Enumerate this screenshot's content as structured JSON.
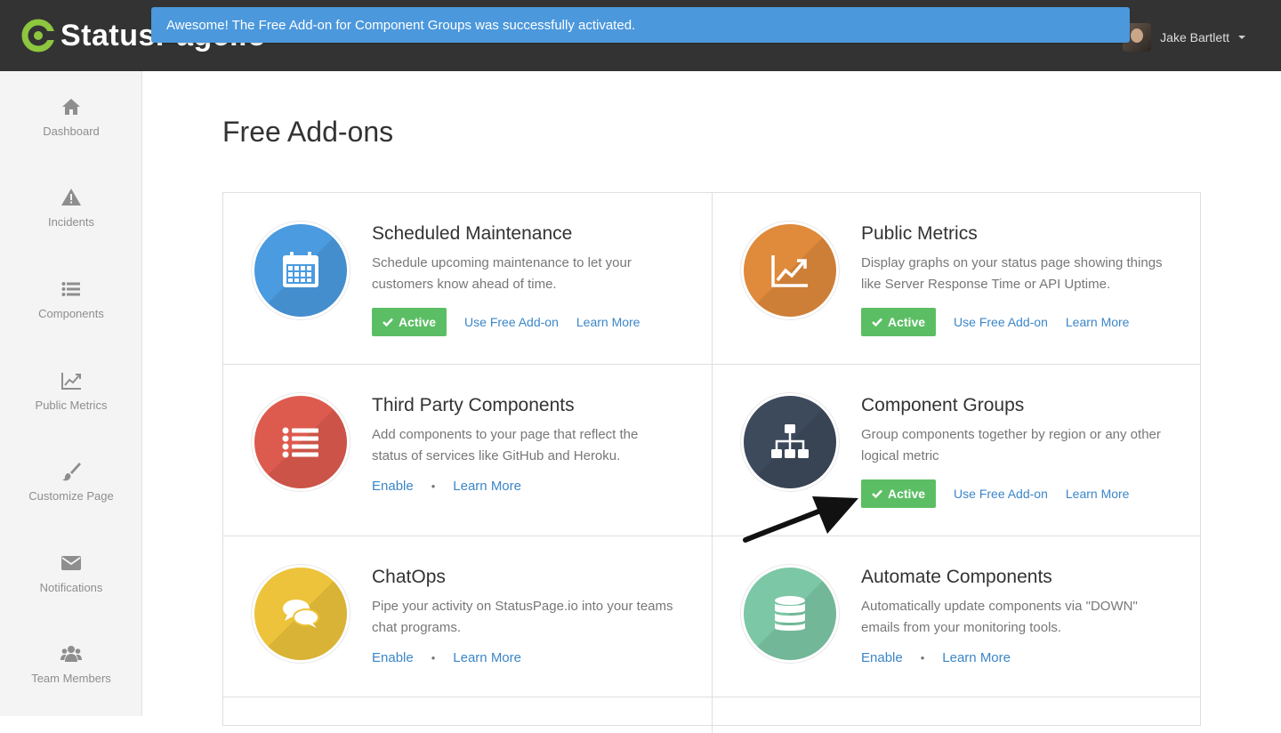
{
  "header": {
    "logo_text": "StatusPage.io",
    "user_name": "Jake Bartlett",
    "flash_message": "Awesome! The Free Add-on for Component Groups was successfully activated."
  },
  "sidebar": {
    "items": [
      {
        "label": "Dashboard",
        "icon": "home-icon"
      },
      {
        "label": "Incidents",
        "icon": "warning-icon"
      },
      {
        "label": "Components",
        "icon": "list-icon"
      },
      {
        "label": "Public Metrics",
        "icon": "chart-icon"
      },
      {
        "label": "Customize Page",
        "icon": "brush-icon"
      },
      {
        "label": "Notifications",
        "icon": "envelope-icon"
      },
      {
        "label": "Team Members",
        "icon": "users-icon"
      }
    ]
  },
  "main": {
    "title": "Free Add-ons",
    "addons": [
      {
        "title": "Scheduled Maintenance",
        "desc": "Schedule upcoming maintenance to let your customers know ahead of time.",
        "status": "Active",
        "use": "Use Free Add-on",
        "learn": "Learn More",
        "color": "#4a9be0",
        "icon": "calendar-icon"
      },
      {
        "title": "Public Metrics",
        "desc": "Display graphs on your status page showing things like Server Response Time or API Uptime.",
        "status": "Active",
        "use": "Use Free Add-on",
        "learn": "Learn More",
        "color": "#e08a3c",
        "icon": "chart-icon"
      },
      {
        "title": "Third Party Components",
        "desc": "Add components to your page that reflect the status of services like GitHub and Heroku.",
        "enable": "Enable",
        "learn": "Learn More",
        "color": "#dd5b4e",
        "icon": "list-icon"
      },
      {
        "title": "Component Groups",
        "desc": "Group components together by region or any other logical metric",
        "status": "Active",
        "use": "Use Free Add-on",
        "learn": "Learn More",
        "color": "#3d4a5c",
        "icon": "sitemap-icon"
      },
      {
        "title": "ChatOps",
        "desc": "Pipe your activity on StatusPage.io into your teams chat programs.",
        "enable": "Enable",
        "learn": "Learn More",
        "color": "#ecc33b",
        "icon": "comments-icon"
      },
      {
        "title": "Automate Components",
        "desc": "Automatically update components via \"DOWN\" emails from your monitoring tools.",
        "enable": "Enable",
        "learn": "Learn More",
        "color": "#7cc7a5",
        "icon": "database-icon"
      }
    ]
  },
  "colors": {
    "topbar": "#333333",
    "flash": "#4b98dc",
    "active_green": "#5cbe64",
    "link_blue": "#3b86c8",
    "logo_green": "#8dc63f"
  }
}
